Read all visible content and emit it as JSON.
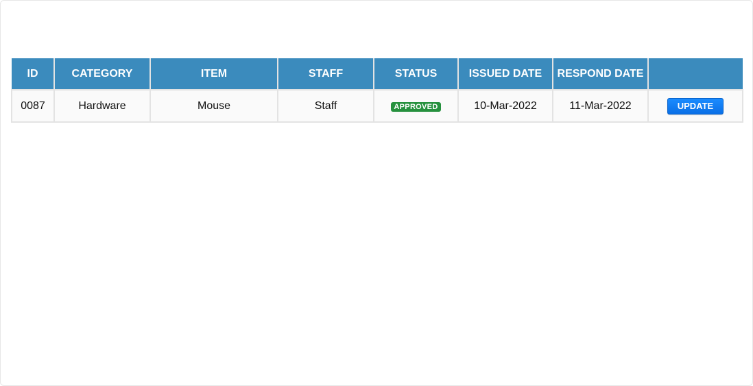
{
  "colors": {
    "header_bg": "#3b8bbd",
    "status_approved": "#26913e",
    "update_button": "#1b8cff"
  },
  "table": {
    "headers": [
      "ID",
      "CATEGORY",
      "ITEM",
      "STAFF",
      "STATUS",
      "ISSUED DATE",
      "RESPOND DATE",
      ""
    ],
    "rows": [
      {
        "id": "0087",
        "category": "Hardware",
        "item": "Mouse",
        "staff": "Staff",
        "status": "APPROVED",
        "issued_date": "10-Mar-2022",
        "respond_date": "11-Mar-2022",
        "action_label": "UPDATE"
      }
    ]
  }
}
